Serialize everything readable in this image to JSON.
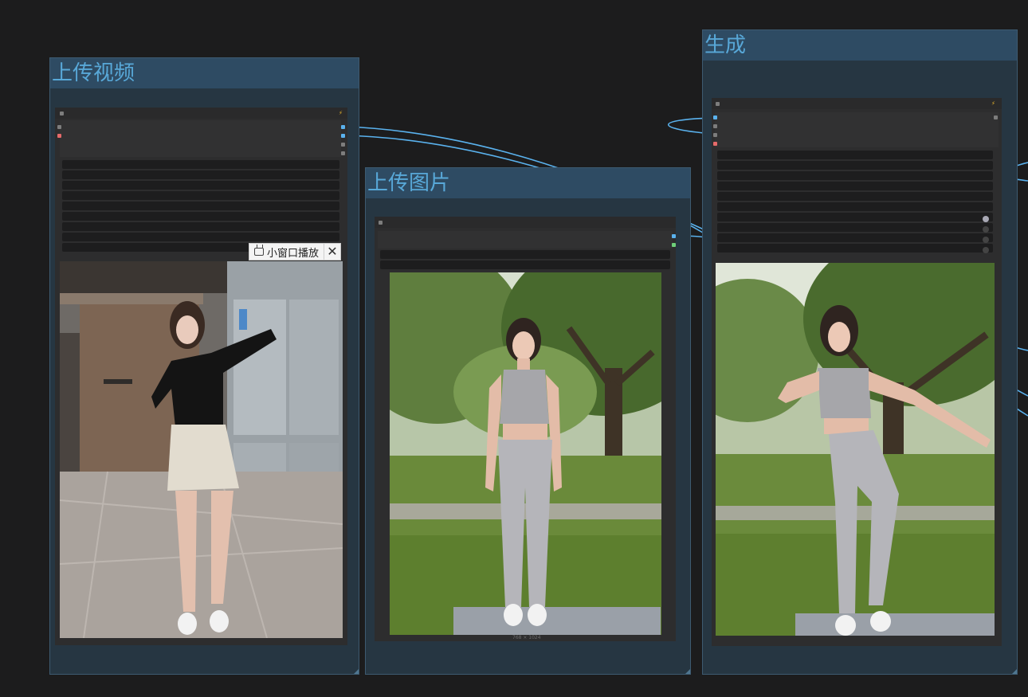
{
  "canvas": {
    "groups": [
      {
        "title": "上传视频"
      },
      {
        "title": "上传图片"
      },
      {
        "title": "生成"
      }
    ],
    "video_overlay": {
      "pip_label": "小窗口播放",
      "close_symbol": "✕"
    },
    "image_caption": "768 × 1024"
  },
  "colors": {
    "background": "#1c1c1d",
    "group_fill": "#263642",
    "group_title_bar": "#2e4b63",
    "group_title_text": "#58a8d8",
    "link": "#5ab2ee"
  },
  "icons": [
    "tv-icon",
    "close-icon",
    "badge-icon"
  ]
}
